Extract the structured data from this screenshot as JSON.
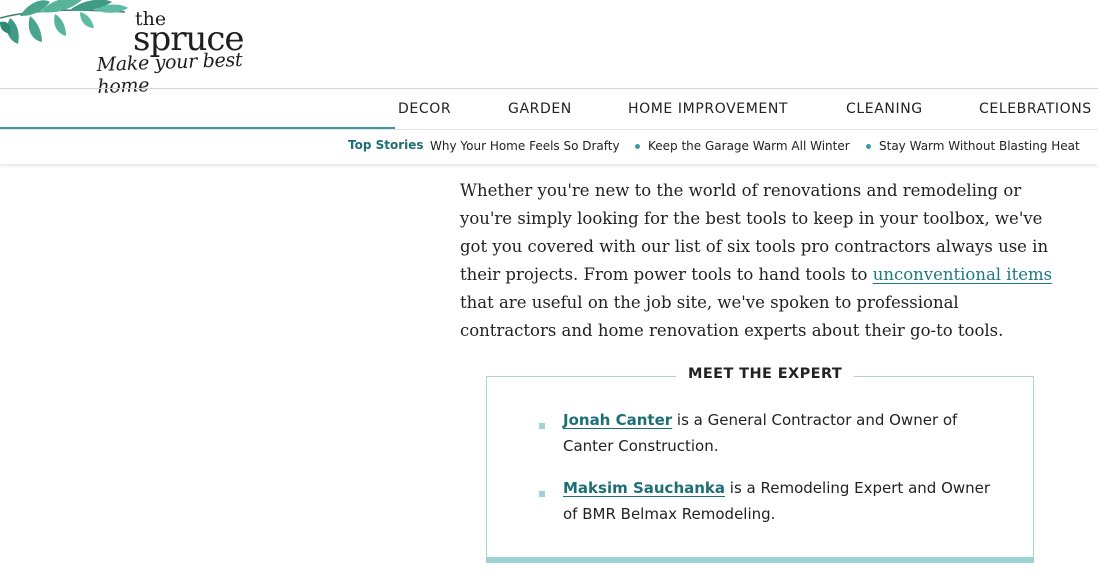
{
  "header": {
    "logo": {
      "the": "the",
      "spruce": "spruce",
      "tagline": "Make your best home"
    }
  },
  "nav": {
    "items": [
      "DECOR",
      "GARDEN",
      "HOME IMPROVEMENT",
      "CLEANING",
      "CELEBRATIONS"
    ]
  },
  "top_stories": {
    "label": "Top Stories",
    "links": [
      "Why Your Home Feels So Drafty",
      "Keep the Garage Warm All Winter",
      "Stay Warm Without Blasting Heat"
    ]
  },
  "article": {
    "intro_before_link": "Whether you're new to the world of renovations and remodeling or you're simply looking for the best tools to keep in your toolbox, we've got you covered with our list of six tools pro contractors always use in their projects. From power tools to hand tools to ",
    "intro_link": "unconventional items",
    "intro_after_link": " that are useful on the job site, we've spoken to professional contractors and home renovation experts about their go-to tools."
  },
  "expert_box": {
    "title": "MEET THE EXPERT",
    "experts": [
      {
        "name": "Jonah Canter",
        "description": " is a General Contractor and Owner of Canter Construction."
      },
      {
        "name": "Maksim Sauchanka",
        "description": " is a Remodeling Expert and Owner of BMR Belmax Remodeling."
      }
    ]
  },
  "colors": {
    "accent": "#3b9aa0",
    "link": "#1d7a80",
    "box_border": "#a8d6d6",
    "box_bar": "#9fd3d3",
    "leaf": "#3f9a86"
  },
  "icons": [
    "leaves-decoration"
  ]
}
